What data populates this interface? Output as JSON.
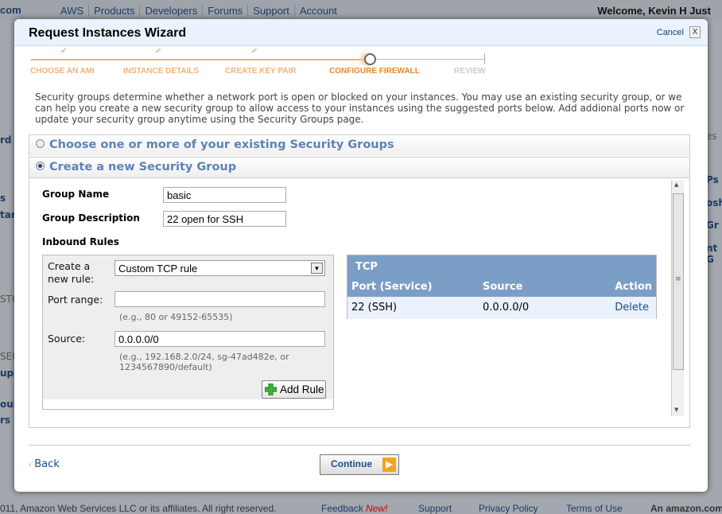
{
  "topbar": {
    "logo_fragment": "com",
    "nav": [
      "AWS",
      "Products",
      "Developers",
      "Forums",
      "Support",
      "Account"
    ],
    "welcome": "Welcome, Kevin H Just"
  },
  "background": {
    "left": [
      "rd",
      "s",
      "tan",
      "STO",
      "SEC",
      "ups",
      "oup",
      "rs"
    ],
    "right": [
      "es",
      "Ps",
      "osh",
      "Gr",
      "nt G"
    ]
  },
  "footer": {
    "copyright": "011, Amazon Web Services LLC or its affiliates. All right reserved.",
    "feedback": "Feedback",
    "new": "New!",
    "support": "Support",
    "privacy": "Privacy Policy",
    "terms": "Terms of Use",
    "brand": "An amazon.com"
  },
  "wizard": {
    "title": "Request Instances Wizard",
    "cancel": "Cancel",
    "close": "X",
    "steps": [
      {
        "label": "CHOOSE AN AMI",
        "done": true
      },
      {
        "label": "INSTANCE DETAILS",
        "done": true
      },
      {
        "label": "CREATE KEY PAIR",
        "done": true
      },
      {
        "label": "CONFIGURE FIREWALL",
        "current": true
      },
      {
        "label": "REVIEW",
        "done": false
      }
    ],
    "intro": "Security groups determine whether a network port is open or blocked on your instances. You may use an existing security group, or we can help you create a new security group to allow access to your instances using the suggested ports below. Add addional ports now or update your security group anytime using the Security Groups page.",
    "option_existing": "Choose one or more of your existing Security Groups",
    "option_new": "Create a new Security Group",
    "group_name_label": "Group Name",
    "group_name": "basic",
    "group_desc_label": "Group Description",
    "group_desc": "22 open for SSH",
    "inbound_label": "Inbound Rules",
    "rule": {
      "create_label": "Create a new rule:",
      "create_value": "Custom TCP rule",
      "port_label": "Port range:",
      "port_value": "",
      "port_hint": "(e.g., 80 or 49152-65535)",
      "source_label": "Source:",
      "source_value": "0.0.0.0/0",
      "source_hint": "(e.g., 192.168.2.0/24, sg-47ad482e, or 1234567890/default)",
      "add_button": "Add Rule"
    },
    "table": {
      "title": "TCP",
      "columns": [
        "Port (Service)",
        "Source",
        "Action"
      ],
      "rows": [
        {
          "port": "22 (SSH)",
          "source": "0.0.0.0/0",
          "action": "Delete"
        }
      ]
    },
    "back": "Back",
    "continue": "Continue"
  },
  "colors": {
    "accent": "#f0b27a",
    "link": "#1a4c8c",
    "table_header": "#7b9ec6",
    "continue_arrow": "#f7a21b"
  }
}
